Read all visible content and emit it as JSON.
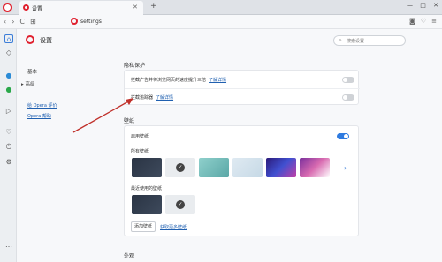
{
  "window": {
    "tab_title": "设置",
    "close": "✕",
    "new_tab": "+",
    "minimize": "—",
    "restore": "□",
    "close_window": "✕"
  },
  "address": {
    "url": "settings",
    "back": "‹",
    "forward": "›",
    "reload": "C",
    "grid": "⊞"
  },
  "settings_nav": {
    "title": "设置",
    "basic": "基本",
    "advanced": "▸ 高级",
    "rate_opera": "给 Opera 评价",
    "opera_help": "Opera 帮助"
  },
  "search": {
    "placeholder": "搜索设置"
  },
  "privacy": {
    "section_title": "隐私保护",
    "ad_block_label": "拦截广告并将浏览网页的速度提升三倍",
    "ad_block_link": "了解详情",
    "ad_block_on": false,
    "tracker_label": "拦截追踪器",
    "tracker_link": "了解详情",
    "tracker_on": false
  },
  "wallpaper": {
    "section_title": "壁纸",
    "enable_label": "启用壁纸",
    "enabled": true,
    "all_label": "所有壁纸",
    "recent_label": "最近使用的壁纸",
    "add_button": "添加壁纸",
    "more_link": "获取更多壁纸",
    "next": "›"
  },
  "appearance": {
    "section_title": "外观"
  },
  "colors": {
    "accent": "#2f7be0",
    "brand": "#e0202e",
    "link": "#2060b0",
    "annotation_arrow": "#c0302a"
  }
}
